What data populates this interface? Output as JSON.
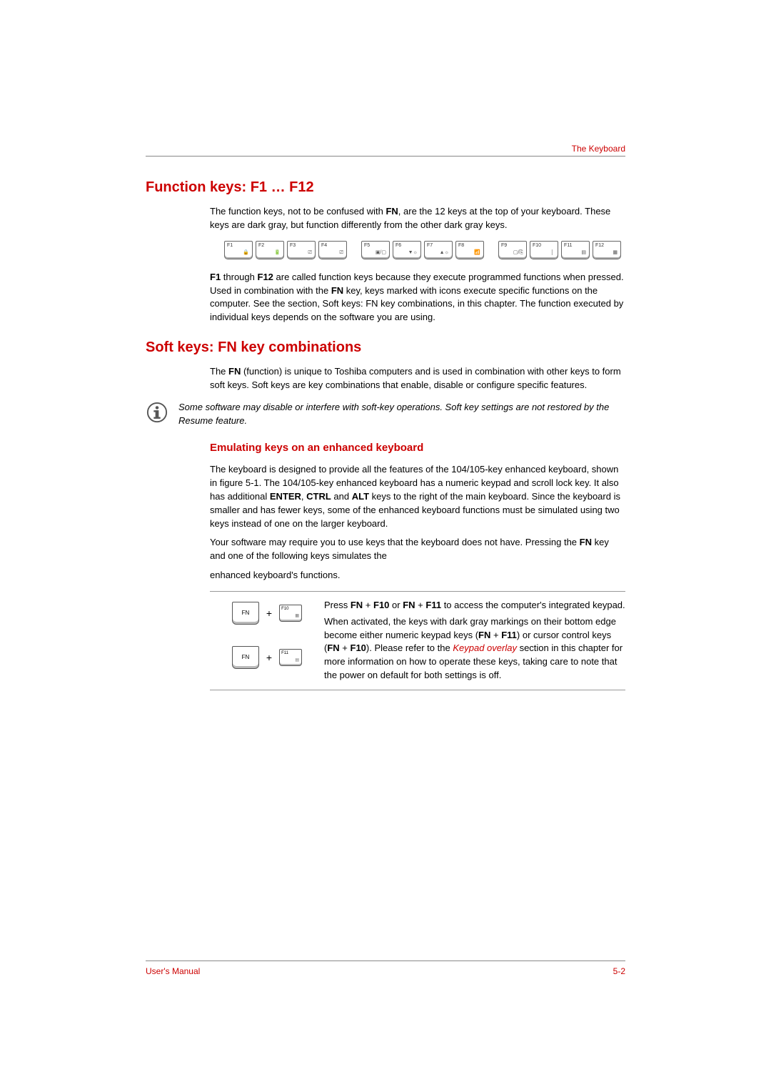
{
  "header": {
    "chapter_title": "The Keyboard"
  },
  "h1": "Function keys: F1 … F12",
  "p1": "The function keys, not to be confused with ",
  "p1b": "FN",
  "p1c": ", are the 12 keys at the top of your keyboard. These keys are dark gray, but function differently from the other dark gray keys.",
  "fkeys": [
    "F1",
    "F2",
    "F3",
    "F4",
    "F5",
    "F6",
    "F7",
    "F8",
    "F9",
    "F10",
    "F11",
    "F12"
  ],
  "ficons": [
    "🔒",
    "🔋",
    "⎚",
    "⎚",
    "▣/▢",
    "▼☼",
    "▲☼",
    "📶",
    "▢/⎘",
    "⡇",
    "▤",
    "▦"
  ],
  "p2a": "F1",
  "p2b": " through ",
  "p2c": "F12",
  "p2d": " are called function keys because they execute programmed functions when pressed. Used in combination with the ",
  "p2e": "FN",
  "p2f": " key, keys marked with icons execute specific functions on the computer. See the section, Soft keys: FN key combinations, in this chapter. The function executed by individual keys depends on the software you are using.",
  "h2": "Soft keys: FN key combinations",
  "p3a": "The ",
  "p3b": "FN",
  "p3c": " (function) is unique to Toshiba computers and is used in combination with other keys to form soft keys. Soft keys are key combinations that enable, disable or configure specific features.",
  "note": "Some software may disable or interfere with soft-key operations. Soft key settings are not restored by the Resume feature.",
  "h3": "Emulating keys on an enhanced keyboard",
  "p4a": "The keyboard is designed to provide all the features of the 104/105-key enhanced keyboard, shown in figure 5-1. The 104/105-key enhanced keyboard has a numeric keypad and scroll lock key. It also has additional ",
  "p4b": "ENTER",
  "p4c": ", ",
  "p4d": "CTRL",
  "p4e": " and ",
  "p4f": "ALT",
  "p4g": " keys to the right of the main keyboard. Since the keyboard is smaller and has fewer keys, some of the enhanced keyboard functions must be simulated using two keys instead of one on the larger keyboard.",
  "p5a": "Your software may require you to use keys that the keyboard does not have. Pressing the ",
  "p5b": "FN",
  "p5c": " key and one of the following keys simulates the",
  "p6": "enhanced keyboard's functions.",
  "combo": {
    "fn": "FN",
    "plus": "+",
    "k1": "F10",
    "k2": "F11",
    "r1a": "Press ",
    "r1b": "FN",
    "r1c": " + ",
    "r1d": "F10",
    "r1e": " or ",
    "r1f": "FN",
    "r1g": " + ",
    "r1h": "F11",
    "r1i": " to access the computer's integrated keypad.",
    "r2a": "When activated, the keys with dark gray markings on their bottom edge become either numeric keypad keys (",
    "r2b": "FN",
    "r2c": " + ",
    "r2d": "F11",
    "r2e": ") or cursor control keys (",
    "r2f": "FN",
    "r2g": " + ",
    "r2h": "F10",
    "r2i": "). Please refer to the ",
    "r2link": "Keypad overlay",
    "r2j": " section in this chapter for more information on how to operate these keys, taking care to note that the power on default for both settings is off."
  },
  "footer": {
    "left": "User's Manual",
    "right": "5-2"
  }
}
